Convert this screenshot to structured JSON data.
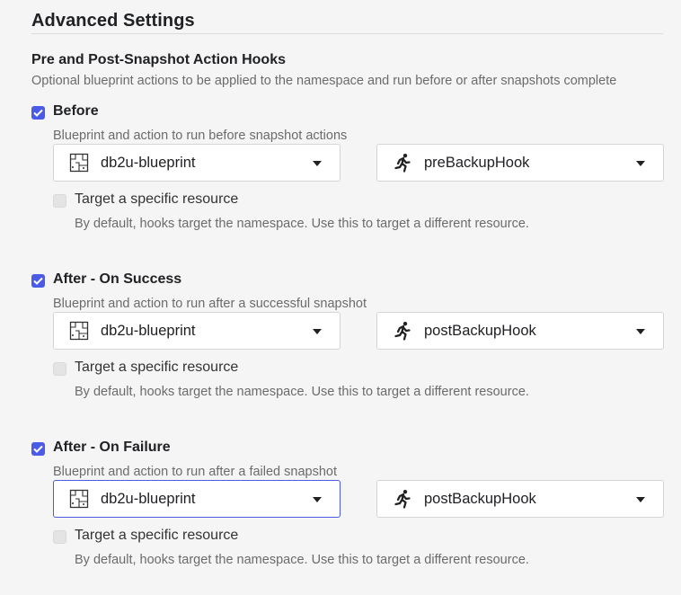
{
  "page": {
    "title": "Advanced Settings"
  },
  "section": {
    "title": "Pre and Post-Snapshot Action Hooks",
    "description": "Optional blueprint actions to be applied to the namespace and run before or after snapshots complete"
  },
  "hooks": [
    {
      "label": "Before",
      "checked": true,
      "description": "Blueprint and action to run before snapshot actions",
      "blueprint": "db2u-blueprint",
      "action": "preBackupHook",
      "target_label": "Target a specific resource",
      "target_checked": false,
      "target_description": "By default, hooks target the namespace. Use this to target a different resource."
    },
    {
      "label": "After - On Success",
      "checked": true,
      "description": "Blueprint and action to run after a successful snapshot",
      "blueprint": "db2u-blueprint",
      "action": "postBackupHook",
      "target_label": "Target a specific resource",
      "target_checked": false,
      "target_description": "By default, hooks target the namespace. Use this to target a different resource."
    },
    {
      "label": "After - On Failure",
      "checked": true,
      "description": "Blueprint and action to run after a failed snapshot",
      "blueprint": "db2u-blueprint",
      "action": "postBackupHook",
      "target_label": "Target a specific resource",
      "target_checked": false,
      "target_description": "By default, hooks target the namespace. Use this to target a different resource."
    }
  ],
  "icons": {
    "blueprint": "blueprint-icon",
    "action": "running-person-icon",
    "dropdown": "caret-down-icon",
    "checkbox": "checkmark-icon"
  },
  "colors": {
    "accent": "#4a5be5",
    "background": "#f5f5f5",
    "muted_text": "#6b6b6b"
  }
}
